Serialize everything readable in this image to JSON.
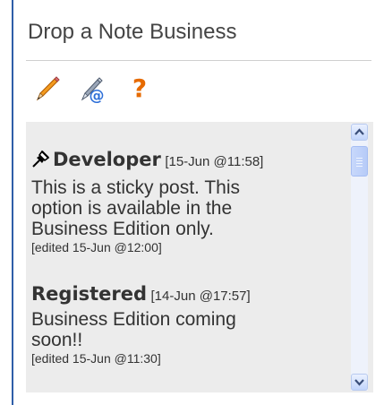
{
  "widget": {
    "title": "Drop a Note Business"
  },
  "toolbar": {
    "tools": [
      {
        "icon": "pencil-icon"
      },
      {
        "icon": "pencil-email-icon"
      },
      {
        "icon": "help-icon",
        "glyph": "?"
      }
    ]
  },
  "notes": [
    {
      "pinned": true,
      "icon": "pin-icon",
      "author": "Developer",
      "timestamp": "[15-Jun @11:58]",
      "text": "This is a sticky post. This\noption is available in the\nBusiness Edition only.",
      "edited": "[edited 15-Jun @12:00]"
    },
    {
      "pinned": false,
      "author": "Registered",
      "timestamp": "[14-Jun @17:57]",
      "text": "Business Edition coming\nsoon!!",
      "edited": "[edited 15-Jun @11:30]"
    }
  ],
  "colors": {
    "accent": "#2e5ea8",
    "notes_bg": "#ececec",
    "help": "#e66a00"
  }
}
